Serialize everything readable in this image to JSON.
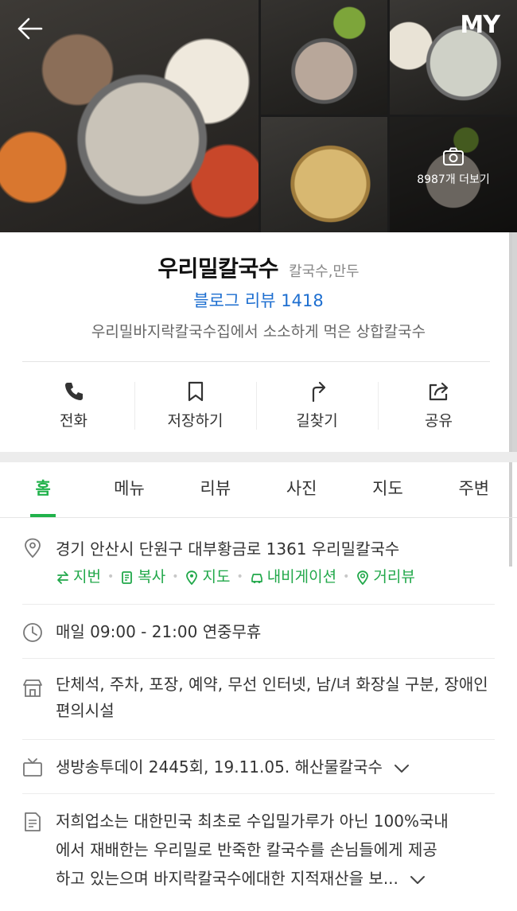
{
  "header": {
    "back_label": "←",
    "my_label": "MY",
    "more_photos_label": "8987개 더보기"
  },
  "place": {
    "name": "우리밀칼국수",
    "category": "칼국수,만두",
    "blog_review": "블로그 리뷰 1418",
    "description": "우리밀바지락칼국수집에서 소소하게 먹은 상합칼국수"
  },
  "actions": [
    {
      "label": "전화",
      "icon": "phone-icon"
    },
    {
      "label": "저장하기",
      "icon": "bookmark-icon"
    },
    {
      "label": "길찾기",
      "icon": "directions-icon"
    },
    {
      "label": "공유",
      "icon": "share-icon"
    }
  ],
  "tabs": [
    {
      "label": "홈",
      "active": true
    },
    {
      "label": "메뉴",
      "active": false
    },
    {
      "label": "리뷰",
      "active": false
    },
    {
      "label": "사진",
      "active": false
    },
    {
      "label": "지도",
      "active": false
    },
    {
      "label": "주변",
      "active": false
    }
  ],
  "details": {
    "address": "경기 안산시 단원구 대부황금로 1361 우리밀칼국수",
    "address_links": [
      {
        "label": "지번",
        "icon": "swap-icon"
      },
      {
        "label": "복사",
        "icon": "copy-icon"
      },
      {
        "label": "지도",
        "icon": "pin-icon"
      },
      {
        "label": "내비게이션",
        "icon": "car-icon"
      },
      {
        "label": "거리뷰",
        "icon": "streetview-icon"
      }
    ],
    "hours": "매일 09:00 - 21:00 연중무휴",
    "facilities": "단체석, 주차, 포장, 예약, 무선 인터넷, 남/녀 화장실 구분, 장애인 편의시설",
    "tv": "생방송투데이 2445회, 19.11.05. 해산물칼국수",
    "intro_line1": "저희업소는 대한민국 최초로 수입밀가루가 아닌 100%국내",
    "intro_line2": "에서 재배한는 우리밀로 반죽한 칼국수를 손님들에게 제공",
    "intro_line3": "하고 있는으며 바지락칼국수에대한 지적재산을 보..."
  },
  "colors": {
    "accent_green": "#21b24b",
    "link_blue": "#1e6fd0"
  }
}
